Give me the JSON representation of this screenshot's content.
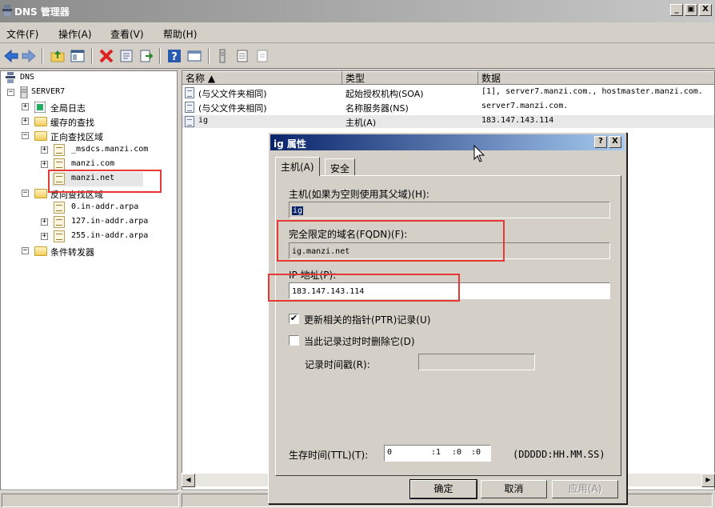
{
  "window": {
    "title": "DNS 管理器",
    "btn_min": "_",
    "btn_max": "ð",
    "btn_close": "X"
  },
  "menu": [
    "文件(F)",
    "操作(A)",
    "查看(V)",
    "帮助(H)"
  ],
  "toolbar": {
    "buttons": [
      "back-icon",
      "forward-icon",
      "up-folder-icon",
      "show-hide-tree-icon",
      "delete-icon",
      "properties-icon",
      "export-list-icon",
      "help-icon",
      "view-icon",
      "server-icon",
      "list-icon",
      "new-record-icon"
    ]
  },
  "tree": {
    "root": "DNS",
    "server": "SERVER7",
    "global_log": "全局日志",
    "cached_lookups": "缓存的查找",
    "forward_zones": "正向查找区域",
    "forward_items": [
      "_msdcs.manzi.com",
      "manzi.com",
      "manzi.net"
    ],
    "reverse_zones": "反向查找区域",
    "reverse_items": [
      "0.in-addr.arpa",
      "127.in-addr.arpa",
      "255.in-addr.arpa"
    ],
    "conditional_forwarders": "条件转发器"
  },
  "list": {
    "columns": [
      "名称 ▲",
      "类型",
      "数据"
    ],
    "rows": [
      {
        "name": "(与父文件夹相同)",
        "type": "起始授权机构(SOA)",
        "data": "[1], server7.manzi.com., hostmaster.manzi.com."
      },
      {
        "name": "(与父文件夹相同)",
        "type": "名称服务器(NS)",
        "data": "server7.manzi.com."
      },
      {
        "name": "ig",
        "type": "主机(A)",
        "data": "183.147.143.114"
      }
    ]
  },
  "dialog": {
    "title": "ig 属性",
    "help_btn": "?",
    "close_btn": "X",
    "tabs": [
      "主机(A)",
      "安全"
    ],
    "host_label": "主机(如果为空则使用其父域)(H):",
    "host_value": "ig",
    "fqdn_label": "完全限定的域名(FQDN)(F):",
    "fqdn_value": "ig.manzi.net",
    "ip_label": "IP 地址(P):",
    "ip_value": "183.147.143.114",
    "ptr_label": "更新相关的指针(PTR)记录(U)",
    "ptr_checked": "✔",
    "delete_label": "当此记录过时时删除它(D)",
    "timestamp_label": "记录时间戳(R):",
    "timestamp_value": "",
    "ttl_label": "生存时间(TTL)(T):",
    "ttl_d": "0",
    "ttl_h": ":1",
    "ttl_m": ":0",
    "ttl_s": ":0",
    "ttl_format": "(DDDDD:HH.MM.SS)",
    "ok": "确定",
    "cancel": "取消",
    "apply": "应用(A)"
  },
  "scroll": {
    "left": "◀",
    "right": "▶"
  }
}
